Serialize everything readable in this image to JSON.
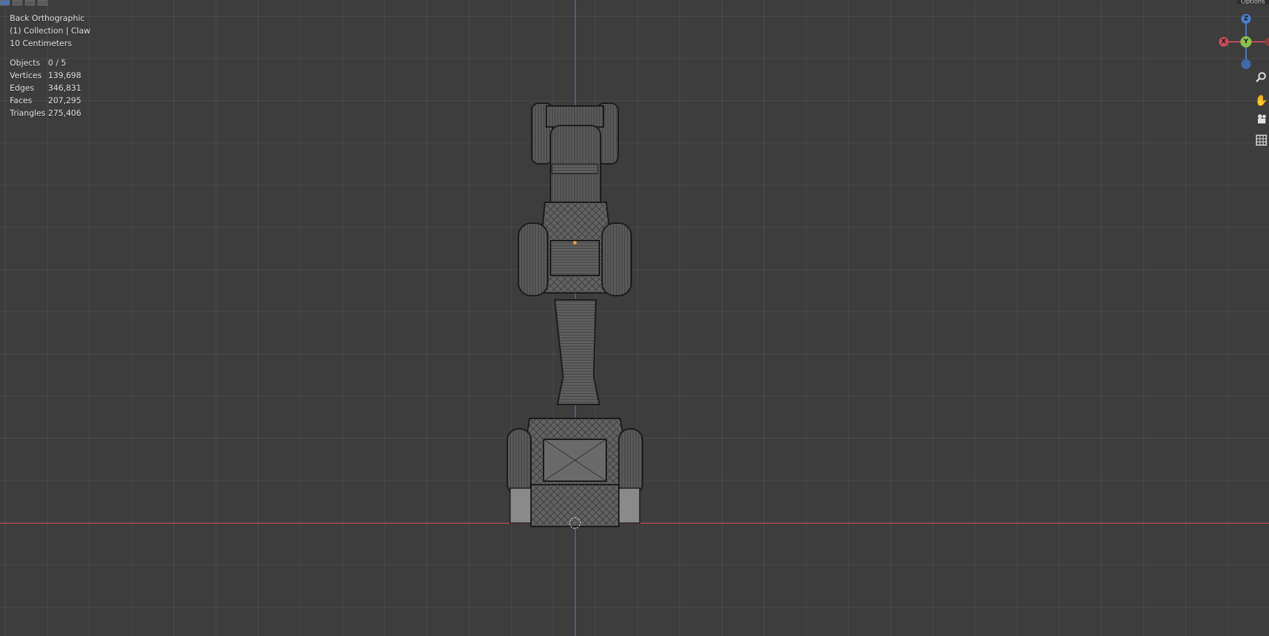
{
  "viewport": {
    "view_name": "Back Orthographic",
    "collection": "(1) Collection | Claw",
    "scale": "10 Centimeters",
    "stats": [
      {
        "label": "Objects",
        "value": "0 / 5"
      },
      {
        "label": "Vertices",
        "value": "139,698"
      },
      {
        "label": "Edges",
        "value": "346,831"
      },
      {
        "label": "Faces",
        "value": "207,295"
      },
      {
        "label": "Triangles",
        "value": "275,406"
      }
    ]
  },
  "header": {
    "options_label": "Options"
  },
  "gizmo": {
    "z": "Z",
    "y": "Y",
    "x": "X"
  },
  "nav_tools": [
    "zoom-icon",
    "pan-hand-icon",
    "camera-icon",
    "grid-ortho-icon"
  ],
  "colors": {
    "background": "#3d3d3d",
    "x_axis": "#c84c55",
    "z_axis": "#4a7fcb",
    "y_axis": "#8bc34a"
  }
}
